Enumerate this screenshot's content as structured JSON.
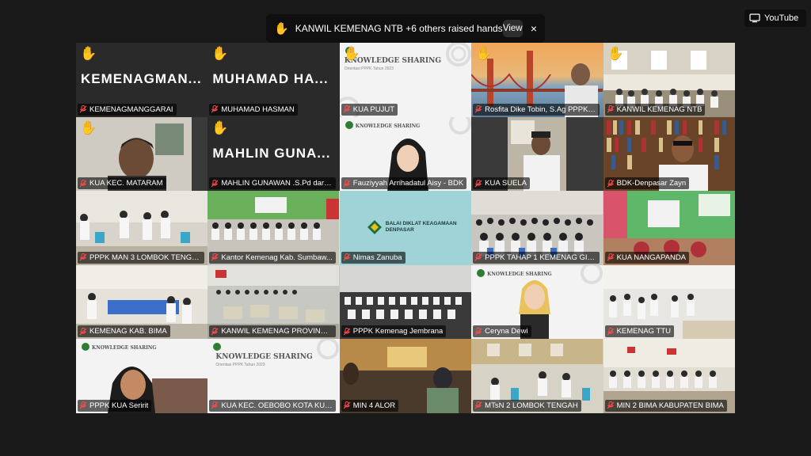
{
  "notification": {
    "text": "KANWIL KEMENAG NTB +6 others raised hands",
    "view_label": "View",
    "close_symbol": "×",
    "hand_symbol": "✋"
  },
  "youtube": {
    "label": "YouTube"
  },
  "slides": {
    "ks_title": "KNOWLEDGE SHARING",
    "ks_sub": "Orientasi PPPK Tahun 2023",
    "balai": "BALAI DIKLAT KEAGAMAAN\nDENPASAR"
  },
  "tiles": [
    {
      "label": "KEMENAGMANGGARAI",
      "big": "KEMENAGMAN...",
      "hand": true
    },
    {
      "label": "MUHAMAD HASMAN",
      "big": "MUHAMAD HA...",
      "hand": true
    },
    {
      "label": "KUA PUJUT",
      "hand": true
    },
    {
      "label": "Rosfita Dike Tobin, S.Ag PPPK K...",
      "hand": true
    },
    {
      "label": "KANWIL KEMENAG NTB",
      "hand": true
    },
    {
      "label": "KUA KEC. MATARAM",
      "hand": true
    },
    {
      "label": "MAHLIN GUNAWAN .S.Pd dari ...",
      "big": "MAHLIN GUNA...",
      "hand": true
    },
    {
      "label": "Fauziyyah Arrihadatul Aisy - BDK"
    },
    {
      "label": "KUA SUELA"
    },
    {
      "label": "BDK-Denpasar Zayn",
      "active": true
    },
    {
      "label": "PPPK MAN 3 LOMBOK TENGAH"
    },
    {
      "label": "Kantor Kemenag Kab. Sumbaw..."
    },
    {
      "label": "Nimas Zanuba"
    },
    {
      "label": "PPPK TAHAP 1 KEMENAG GIAN..."
    },
    {
      "label": "KUA NANGAPANDA"
    },
    {
      "label": "KEMENAG KAB. BIMA"
    },
    {
      "label": "KANWIL KEMENAG PROVINSI ..."
    },
    {
      "label": "PPPK Kemenag Jembrana"
    },
    {
      "label": "Ceryna Dewi"
    },
    {
      "label": "KEMENAG TTU"
    },
    {
      "label": "PPPK KUA Seririt"
    },
    {
      "label": "KUA KEC. OEBOBO KOTA KUPA..."
    },
    {
      "label": "MIN 4 ALOR"
    },
    {
      "label": "MTsN 2 LOMBOK TENGAH"
    },
    {
      "label": "MIN 2 BIMA KABUPATEN BIMA"
    }
  ]
}
